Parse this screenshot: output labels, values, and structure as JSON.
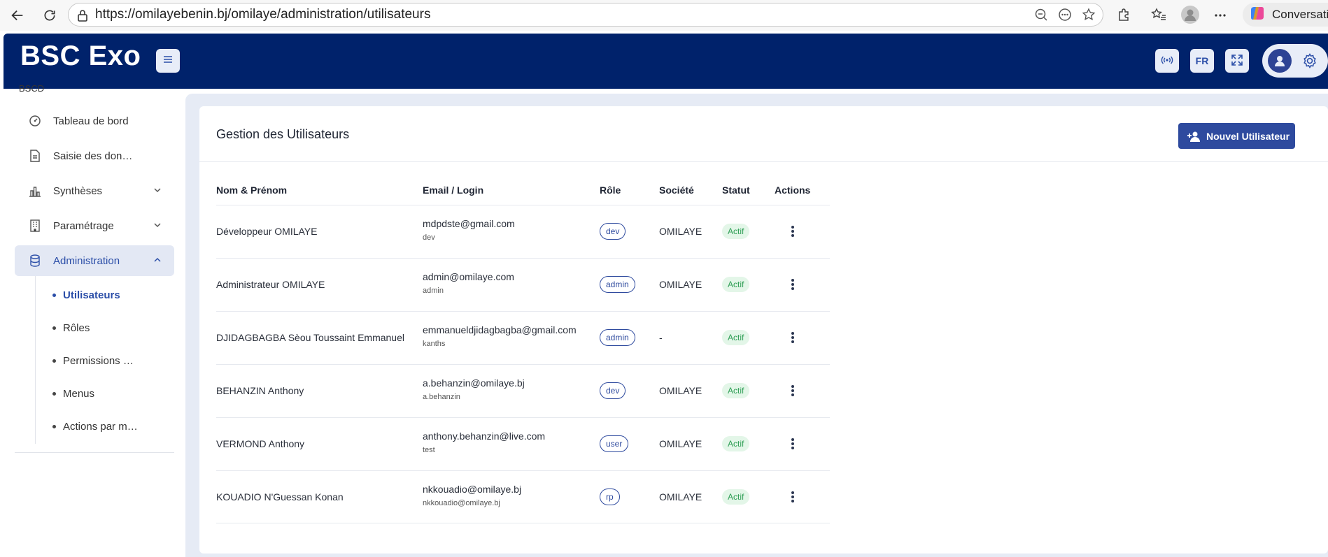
{
  "browser": {
    "url": "https://omilayebenin.bj/omilaye/administration/utilisateurs",
    "copilot_label": "Conversation"
  },
  "header": {
    "brand": "BSC Exo",
    "lang_label": "FR"
  },
  "sidebar": {
    "org_label": "BSCD",
    "items": [
      {
        "label": "Tableau de bord",
        "icon": "dashboard-gauge-icon"
      },
      {
        "label": "Saisie des don…",
        "icon": "document-icon"
      },
      {
        "label": "Synthèses",
        "icon": "bar-chart-icon"
      },
      {
        "label": "Paramétrage",
        "icon": "building-icon"
      },
      {
        "label": "Administration",
        "icon": "database-icon"
      }
    ],
    "sub_items": [
      "Utilisateurs",
      "Rôles",
      "Permissions …",
      "Menus",
      "Actions par m…"
    ]
  },
  "main": {
    "title": "Gestion des Utilisateurs",
    "new_button": "Nouvel Utilisateur",
    "columns": [
      "Nom & Prénom",
      "Email / Login",
      "Rôle",
      "Société",
      "Statut",
      "Actions"
    ],
    "rows": [
      {
        "name": "Développeur OMILAYE",
        "email": "mdpdste@gmail.com",
        "login": "dev",
        "role": "dev",
        "company": "OMILAYE",
        "status": "Actif"
      },
      {
        "name": "Administrateur OMILAYE",
        "email": "admin@omilaye.com",
        "login": "admin",
        "role": "admin",
        "company": "OMILAYE",
        "status": "Actif"
      },
      {
        "name": "DJIDAGBAGBA Sèou Toussaint Emmanuel",
        "email": "emmanueldjidagbagba@gmail.com",
        "login": "kanths",
        "role": "admin",
        "company": "-",
        "status": "Actif"
      },
      {
        "name": "BEHANZIN Anthony",
        "email": "a.behanzin@omilaye.bj",
        "login": "a.behanzin",
        "role": "dev",
        "company": "OMILAYE",
        "status": "Actif"
      },
      {
        "name": "VERMOND Anthony",
        "email": "anthony.behanzin@live.com",
        "login": "test",
        "role": "user",
        "company": "OMILAYE",
        "status": "Actif"
      },
      {
        "name": "KOUADIO N'Guessan Konan",
        "email": "nkkouadio@omilaye.bj",
        "login": "nkkouadio@omilaye.bj",
        "role": "rp",
        "company": "OMILAYE",
        "status": "Actif"
      }
    ]
  },
  "colors": {
    "header_bg": "#00226b",
    "accent": "#2e4a9e",
    "status_green": "#2f9e55",
    "content_bg": "#e6ebf5"
  }
}
